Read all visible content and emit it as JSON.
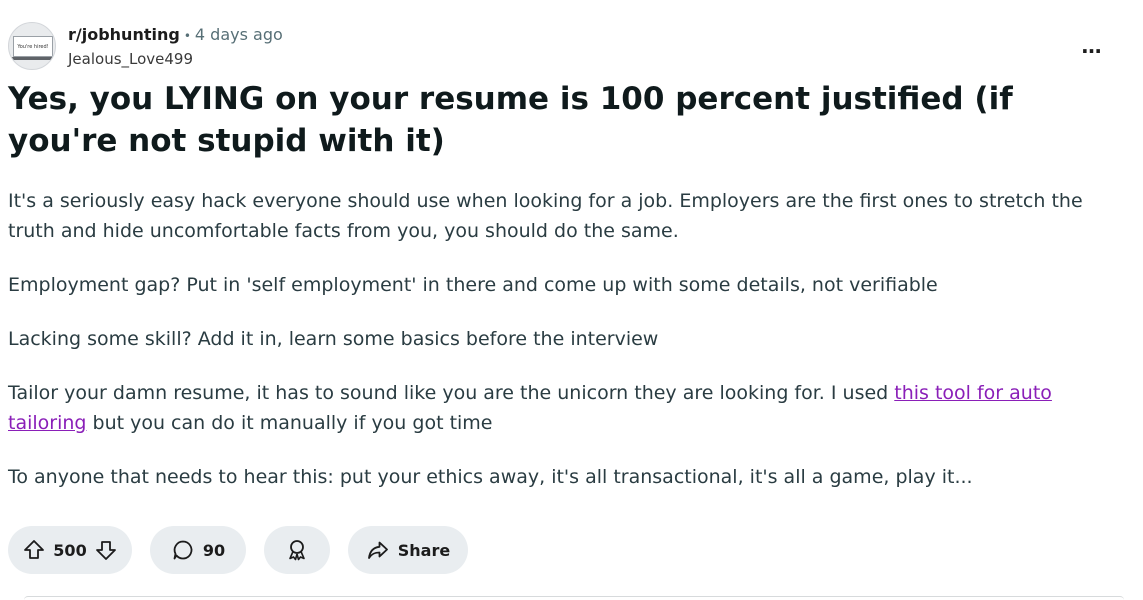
{
  "post": {
    "avatar_text": "You're hired!",
    "subreddit": "r/jobhunting",
    "separator": "•",
    "time": "4 days ago",
    "author": "Jealous_Love499",
    "more_icon": "…",
    "title": "Yes, you LYING on your resume is 100 percent justified (if you're not stupid with it)",
    "paragraphs": {
      "p1": "It's a seriously easy hack everyone should use when looking for a job. Employers are the first ones to stretch the truth and hide uncomfortable facts from you, you should do the same.",
      "p2": "Employment gap? Put in 'self employment' in there and come up with some details, not verifiable",
      "p3": "Lacking some skill? Add it in, learn some basics before the interview",
      "p4_before": "Tailor your damn resume, it has to sound like you are the unicorn they are looking for. I used ",
      "p4_link": "this tool for auto tailoring",
      "p4_after": " but you can do it manually if you got time",
      "p5": "To anyone that needs to hear this: put your ethics away, it's all transactional, it's all a game, play it..."
    }
  },
  "actions": {
    "vote_count": "500",
    "comment_count": "90",
    "share_label": "Share"
  },
  "icons": {
    "upvote": "upvote-icon",
    "downvote": "downvote-icon",
    "comment": "comment-icon",
    "award": "award-icon",
    "share": "share-icon",
    "more": "more-options-icon"
  },
  "colors": {
    "link": "#8a1fb8",
    "pill_bg": "#e9edf0",
    "meta_gray": "#576f76"
  }
}
